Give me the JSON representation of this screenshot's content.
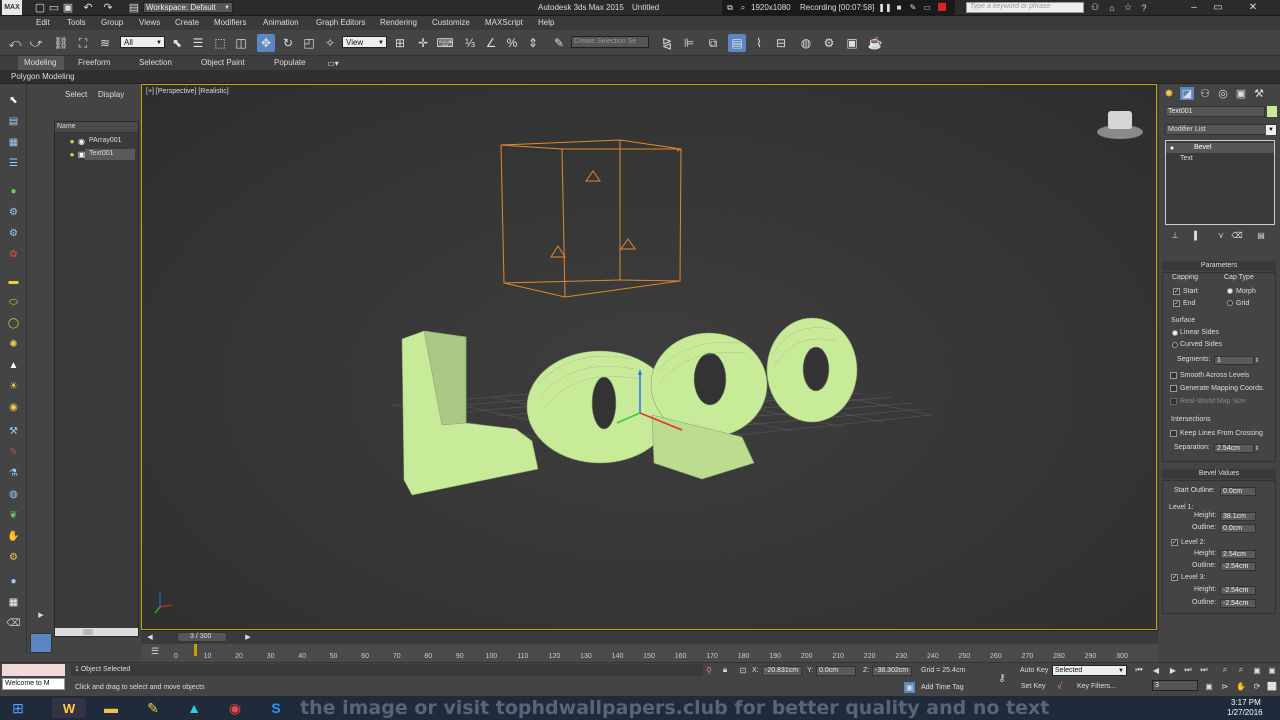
{
  "title_bar": {
    "workspace": "Workspace: Default",
    "app_title": "Autodesk 3ds Max 2015",
    "file_title": "Untitled",
    "resolution": "1920x1080",
    "recording": "Recording [00:07:58]",
    "search_placeholder": "Type a keyword or phrase"
  },
  "menu": [
    "Edit",
    "Tools",
    "Group",
    "Views",
    "Create",
    "Modifiers",
    "Animation",
    "Graph Editors",
    "Rendering",
    "Customize",
    "MAXScript",
    "Help"
  ],
  "toolbar": {
    "selection_filter": "All",
    "ref_coord": "View",
    "named_selection_placeholder": "Create Selection Se"
  },
  "ribbon": {
    "tabs": [
      "Modeling",
      "Freeform",
      "Selection",
      "Object Paint",
      "Populate"
    ],
    "sub": "Polygon Modeling"
  },
  "explorer": {
    "tabs": [
      "Select",
      "Display"
    ],
    "column": "Name",
    "items": [
      "PArray001",
      "Text001"
    ]
  },
  "viewport": {
    "label": "[+] [Perspective] [Realistic]",
    "logo_text": "Logo"
  },
  "command_panel": {
    "object_name": "Text001",
    "modifier_list": "Modifier List",
    "stack": [
      "Bevel",
      "Text"
    ],
    "parameters_title": "Parameters",
    "capping": "Capping",
    "cap_type": "Cap Type",
    "start": "Start",
    "end": "End",
    "morph": "Morph",
    "grid": "Grid",
    "surface": "Surface",
    "linear_sides": "Linear Sides",
    "curved_sides": "Curved Sides",
    "segments_label": "Segments:",
    "segments_value": "1",
    "smooth_across": "Smooth Across Levels",
    "gen_mapping": "Generate Mapping Coords.",
    "real_world": "Real-World Map Size",
    "intersections": "Intersections",
    "keep_lines": "Keep Lines From Crossing",
    "separation_label": "Separation:",
    "separation_value": "2.54cm",
    "bevel_values_title": "Bevel Values",
    "start_outline_label": "Start Outline:",
    "start_outline_value": "0.0cm",
    "level1": "Level 1:",
    "level2": "Level 2:",
    "level3": "Level 3:",
    "height_label": "Height:",
    "outline_label": "Outline:",
    "l1_height": "38.1cm",
    "l1_outline": "0.0cm",
    "l2_height": "2.54cm",
    "l2_outline": "-2.54cm",
    "l3_height": "-2.54cm",
    "l3_outline": "-2.54cm"
  },
  "timeline": {
    "frame": "3 / 300",
    "current_frame": 3,
    "total_frames": 300,
    "ticks": [
      "0",
      "10",
      "20",
      "30",
      "40",
      "50",
      "60",
      "70",
      "80",
      "90",
      "100",
      "110",
      "120",
      "130",
      "140",
      "150",
      "160",
      "170",
      "180",
      "190",
      "200",
      "210",
      "220",
      "230",
      "240",
      "250",
      "260",
      "270",
      "280",
      "290",
      "300"
    ]
  },
  "status": {
    "welcome": "Welcome to M",
    "selected": "1 Object Selected",
    "prompt": "Click and drag to select and move objects",
    "x_label": "X:",
    "x_value": "-20.831cm",
    "y_label": "Y:",
    "y_value": "0.0cm",
    "z_label": "Z:",
    "z_value": "-38.302cm",
    "grid": "Grid = 25.4cm",
    "add_time_tag": "Add Time Tag",
    "auto_key": "Auto Key",
    "selected_dropdown": "Selected",
    "set_key": "Set Key",
    "key_filters": "Key Filters...",
    "frame_field": "3"
  },
  "watermark": "the image or visit tophdwallpapers.club for better quality and no text",
  "taskbar": {
    "time": "3:17 PM",
    "date": "1/27/2016"
  },
  "colors": {
    "logo_fill": "#c8eb9a",
    "box_wire": "#e08a2a",
    "viewport_border": "#c9a200",
    "highlight": "#5a86c2"
  }
}
